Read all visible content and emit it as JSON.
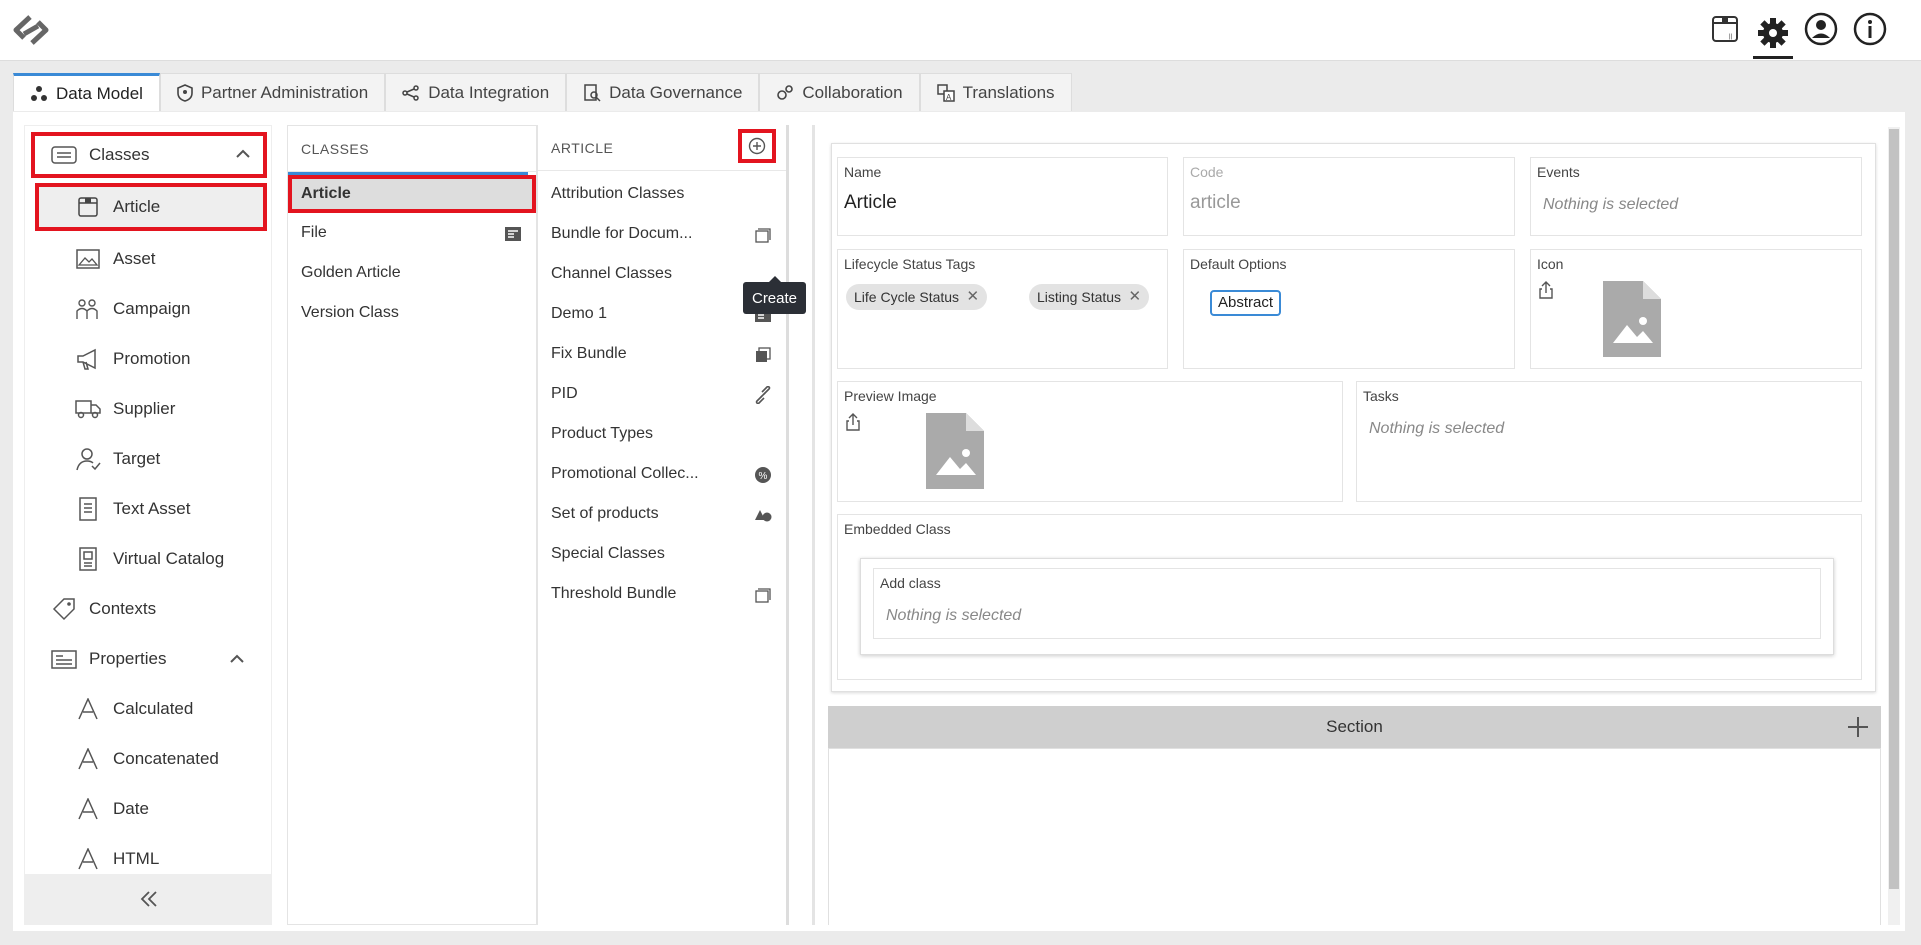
{
  "tabs": [
    {
      "label": "Data Model",
      "icon": "data-model-icon",
      "active": true
    },
    {
      "label": "Partner Administration",
      "icon": "shield-icon"
    },
    {
      "label": "Data Integration",
      "icon": "share-icon"
    },
    {
      "label": "Data Governance",
      "icon": "governance-icon"
    },
    {
      "label": "Collaboration",
      "icon": "gears-icon"
    },
    {
      "label": "Translations",
      "icon": "translate-icon"
    }
  ],
  "sidebar": {
    "classes": {
      "label": "Classes",
      "icon": "classes-icon"
    },
    "class_items": [
      {
        "label": "Article",
        "icon": "article-icon"
      },
      {
        "label": "Asset",
        "icon": "asset-icon"
      },
      {
        "label": "Campaign",
        "icon": "campaign-icon"
      },
      {
        "label": "Promotion",
        "icon": "megaphone-icon"
      },
      {
        "label": "Supplier",
        "icon": "truck-icon"
      },
      {
        "label": "Target",
        "icon": "target-user-icon"
      },
      {
        "label": "Text Asset",
        "icon": "text-doc-icon"
      },
      {
        "label": "Virtual Catalog",
        "icon": "catalog-icon"
      }
    ],
    "contexts": {
      "label": "Contexts",
      "icon": "tag-icon"
    },
    "properties": {
      "label": "Properties",
      "icon": "properties-icon"
    },
    "property_items": [
      {
        "label": "Calculated",
        "icon": "font-a-icon"
      },
      {
        "label": "Concatenated",
        "icon": "font-a-icon"
      },
      {
        "label": "Date",
        "icon": "font-a-icon"
      },
      {
        "label": "HTML",
        "icon": "font-a-icon"
      }
    ]
  },
  "classes_column": {
    "header": "CLASSES",
    "items": [
      {
        "label": "Article",
        "selected": true
      },
      {
        "label": "File",
        "icon": "form-icon"
      },
      {
        "label": "Golden Article"
      },
      {
        "label": "Version Class"
      }
    ]
  },
  "article_column": {
    "header": "ARTICLE",
    "create_tooltip": "Create",
    "items": [
      {
        "label": "Attribution Classes"
      },
      {
        "label": "Bundle for Docum...",
        "icon": "bundle-icon"
      },
      {
        "label": "Channel Classes"
      },
      {
        "label": "Demo 1",
        "icon": "form-icon"
      },
      {
        "label": "Fix Bundle",
        "icon": "boxes-icon"
      },
      {
        "label": "PID",
        "icon": "link-icon"
      },
      {
        "label": "Product Types"
      },
      {
        "label": "Promotional Collec...",
        "icon": "percent-icon"
      },
      {
        "label": "Set of products",
        "icon": "shapes-icon"
      },
      {
        "label": "Special Classes"
      },
      {
        "label": "Threshold Bundle",
        "icon": "bundle-icon"
      }
    ]
  },
  "detail": {
    "name_label": "Name",
    "name_value": "Article",
    "code_label": "Code",
    "code_value": "article",
    "events_label": "Events",
    "events_placeholder": "Nothing is selected",
    "lifecycle_label": "Lifecycle Status Tags",
    "lifecycle_tags": [
      "Life Cycle Status",
      "Listing Status"
    ],
    "tag_remove": "✕",
    "default_options_label": "Default Options",
    "default_option": "Abstract",
    "icon_label": "Icon",
    "preview_label": "Preview Image",
    "tasks_label": "Tasks",
    "tasks_placeholder": "Nothing is selected",
    "embedded_label": "Embedded Class",
    "add_class_label": "Add class",
    "add_class_placeholder": "Nothing is selected",
    "section_label": "Section"
  },
  "colors": {
    "highlight": "#e3141f",
    "accent": "#3a8ad6",
    "tooltip_bg": "#2b2f36"
  }
}
